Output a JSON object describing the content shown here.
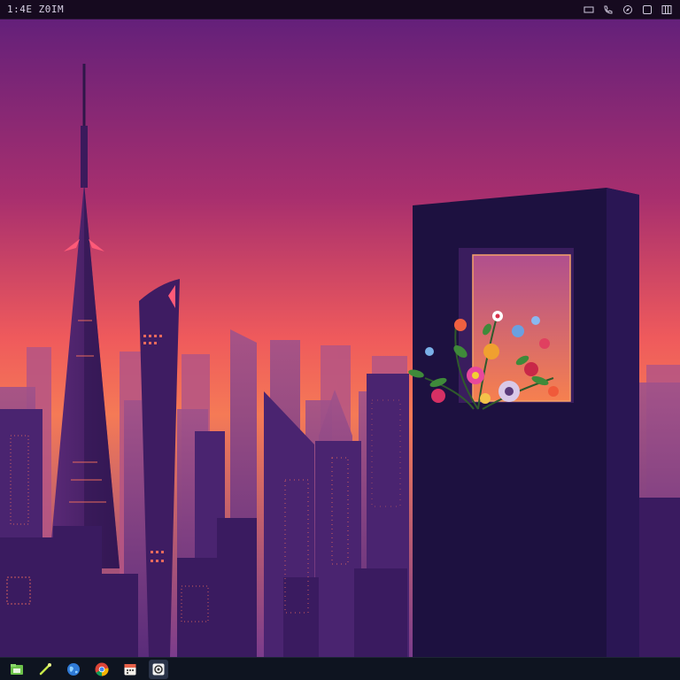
{
  "topbar": {
    "clock": "1:4E Z0IM",
    "tray_icons": [
      "screen-icon",
      "phone-icon",
      "compass-icon",
      "window-icon",
      "grid-icon"
    ]
  },
  "wallpaper": {
    "sky_top": "#6a1f7a",
    "sky_horizon": "#f06a52",
    "tower_color": "#3b1c5c",
    "monolith_color": "#1d1140",
    "window_glow": "#f2784e"
  },
  "taskbar": {
    "apps": [
      {
        "name": "files-app-icon",
        "active": false
      },
      {
        "name": "pen-tool-app-icon",
        "active": false
      },
      {
        "name": "globe-app-icon",
        "active": false
      },
      {
        "name": "chrome-browser-icon",
        "active": false
      },
      {
        "name": "calendar-app-icon",
        "active": false
      },
      {
        "name": "settings-app-icon",
        "active": true
      }
    ]
  }
}
